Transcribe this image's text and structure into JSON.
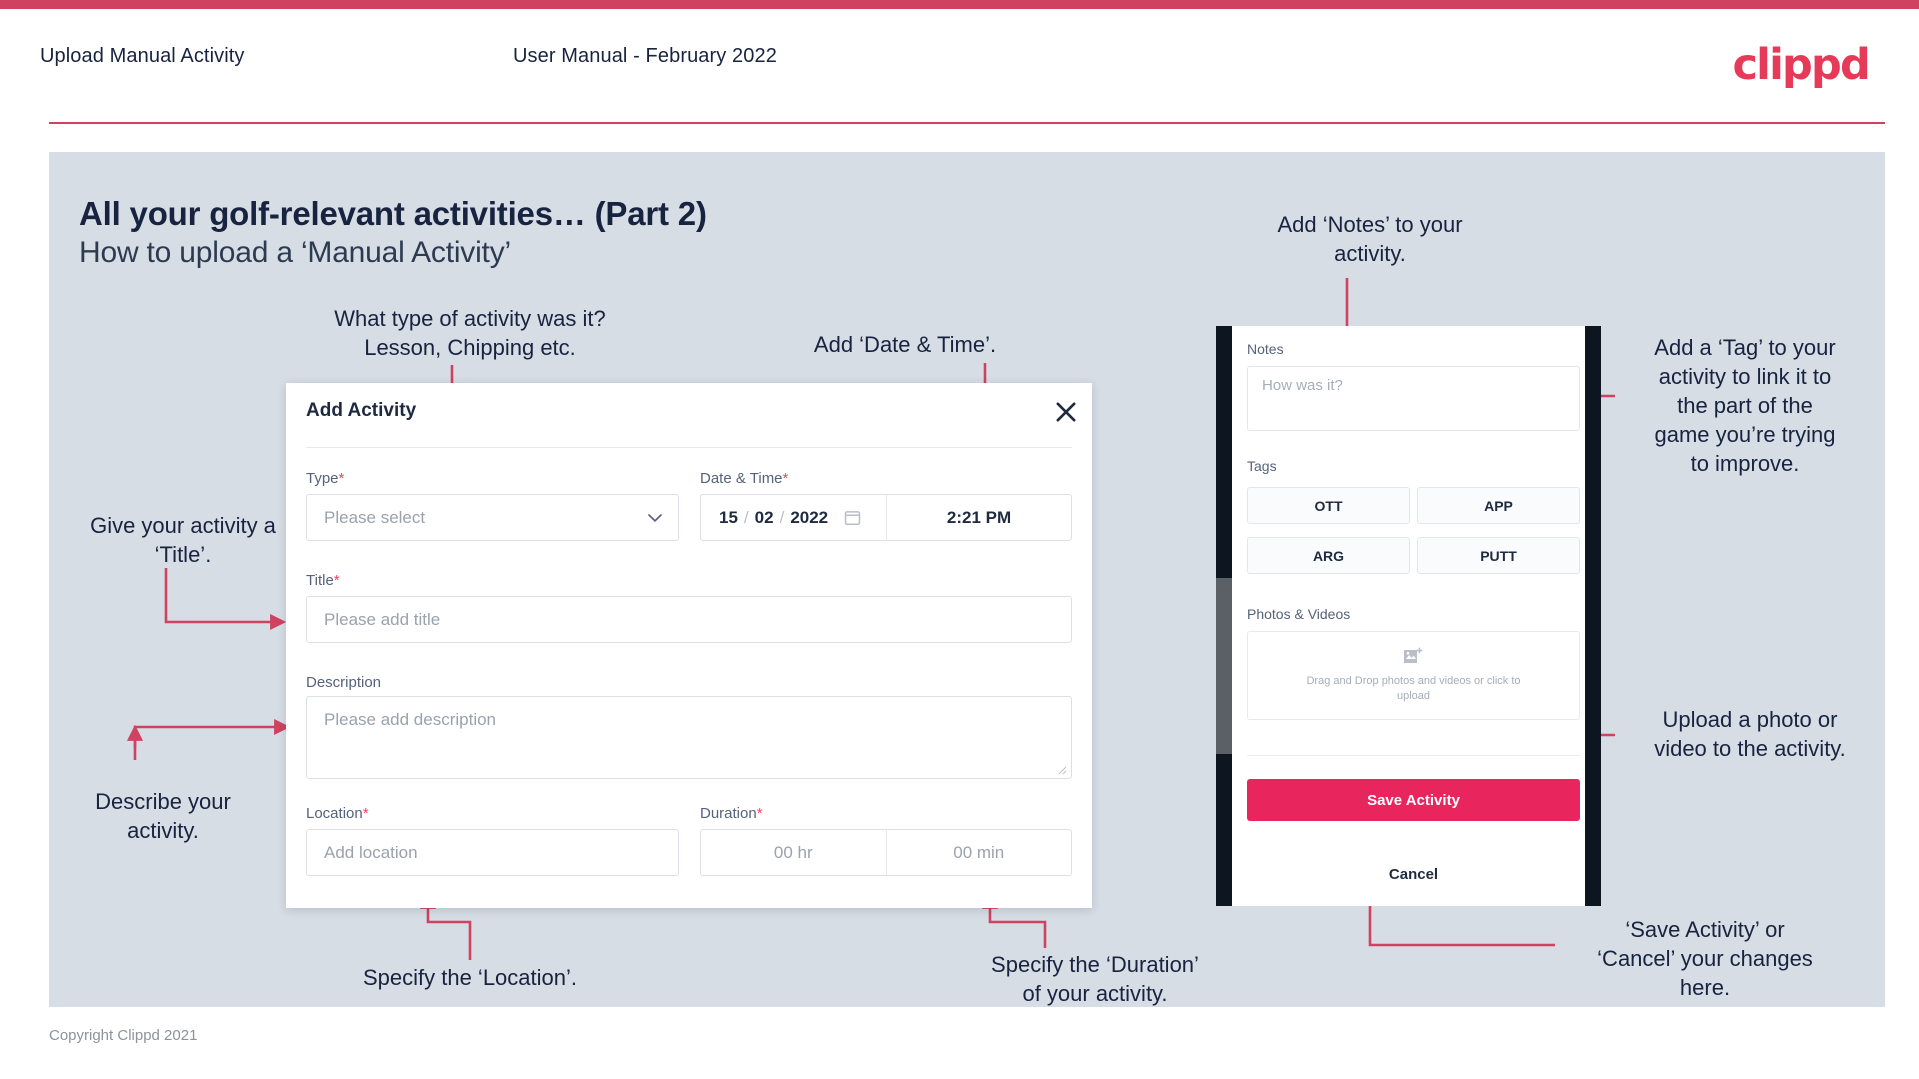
{
  "header": {
    "title": "Upload Manual Activity",
    "subtitle": "User Manual - February 2022",
    "logo": "clippd"
  },
  "slide": {
    "title": "All your golf-relevant activities… (Part 2)",
    "subtitle": "How to upload a ‘Manual Activity’"
  },
  "annotations": {
    "type": "What type of activity was it?\nLesson, Chipping etc.",
    "datetime": "Add ‘Date & Time’.",
    "title_field": "Give your activity a\n‘Title’.",
    "description": "Describe your\nactivity.",
    "location": "Specify the ‘Location’.",
    "duration": "Specify the ‘Duration’\nof your activity.",
    "notes": "Add ‘Notes’ to your\nactivity.",
    "tags": "Add a ‘Tag’ to your\nactivity to link it to\nthe part of the\ngame you’re trying\nto improve.",
    "upload": "Upload a photo or\nvideo to the activity.",
    "save_cancel": "‘Save Activity’ or\n‘Cancel’ your changes\nhere."
  },
  "dialog": {
    "title": "Add Activity",
    "close_icon": "close-icon",
    "fields": {
      "type": {
        "label": "Type",
        "required": "*",
        "placeholder": "Please select"
      },
      "datetime": {
        "label": "Date & Time",
        "required": "*",
        "day": "15",
        "month": "02",
        "year": "2022",
        "sep": "/",
        "time": "2:21 PM"
      },
      "title": {
        "label": "Title",
        "required": "*",
        "placeholder": "Please add title"
      },
      "description": {
        "label": "Description",
        "placeholder": "Please add description"
      },
      "location": {
        "label": "Location",
        "required": "*",
        "placeholder": "Add location"
      },
      "duration": {
        "label": "Duration",
        "required": "*",
        "hours": "00 hr",
        "minutes": "00 min"
      }
    }
  },
  "mobile": {
    "notes_label": "Notes",
    "notes_placeholder": "How was it?",
    "tags_label": "Tags",
    "tags": [
      "OTT",
      "APP",
      "ARG",
      "PUTT"
    ],
    "photos_label": "Photos & Videos",
    "drop_text": "Drag and Drop photos and videos or click to upload",
    "save_label": "Save Activity",
    "cancel_label": "Cancel"
  },
  "footer": {
    "copyright": "Copyright Clippd 2021"
  },
  "colors": {
    "accent": "#cf4360",
    "brand": "#e63b58",
    "save": "#e8255c",
    "slide_bg": "#d7dde5",
    "text": "#17233f"
  }
}
